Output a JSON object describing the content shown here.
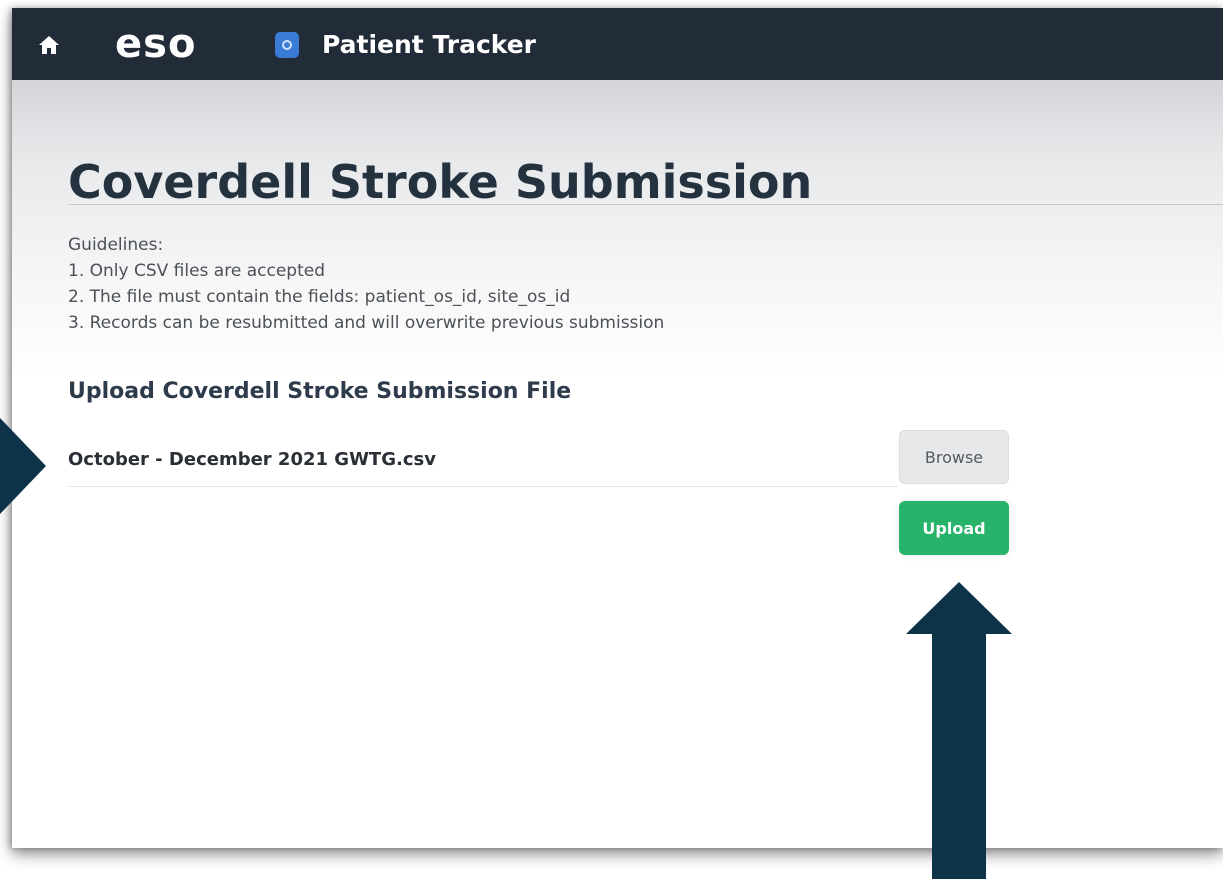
{
  "app": {
    "home_icon": "home-icon",
    "logo_text": "eso",
    "app_icon": "patient-tracker-app-icon",
    "app_title": "Patient Tracker"
  },
  "page": {
    "title": "Coverdell Stroke Submission",
    "guidelines": {
      "heading": "Guidelines:",
      "items": [
        "1. Only CSV files are accepted",
        "2. The file must contain the fields: patient_os_id, site_os_id",
        "3. Records can be resubmitted and will overwrite previous submission"
      ]
    },
    "upload_section": {
      "heading": "Upload Coverdell Stroke Submission File",
      "selected_file": "October - December 2021 GWTG.csv",
      "browse_label": "Browse",
      "upload_label": "Upload"
    }
  },
  "colors": {
    "topbar": "#222b38",
    "upload_button": "#27b36a",
    "browse_button": "#e7e8ea",
    "annotation_arrows": "#0d3349",
    "title_text": "#243240"
  },
  "annotations": {
    "arrow_left_icon": "arrow-right-pointer-icon",
    "arrow_up_icon": "arrow-up-pointer-icon"
  }
}
